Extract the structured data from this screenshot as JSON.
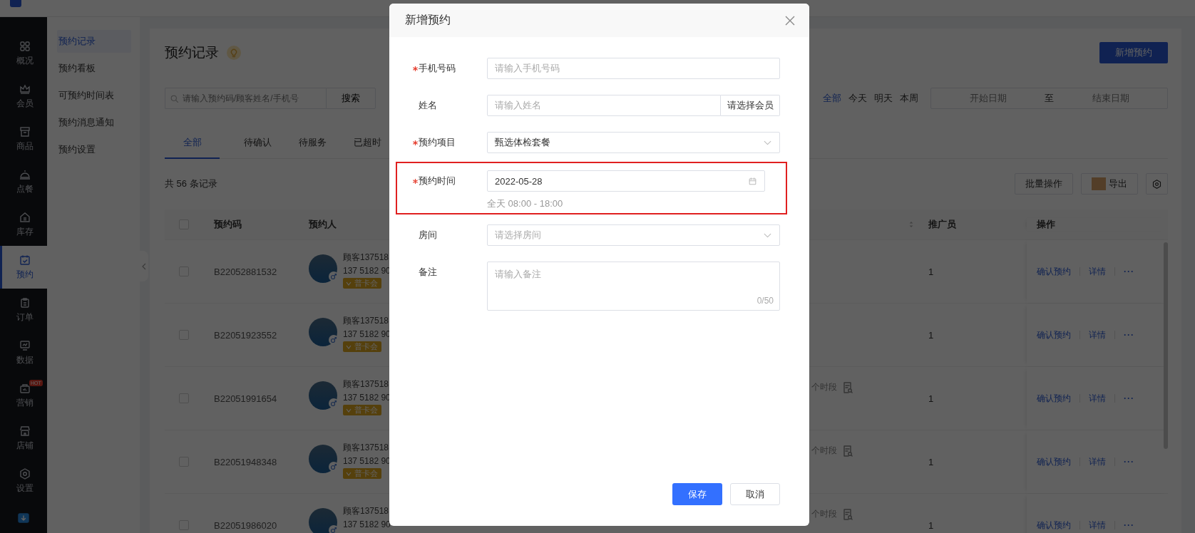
{
  "nav": {
    "items": [
      {
        "label": "概况",
        "selected": false
      },
      {
        "label": "会员",
        "selected": false
      },
      {
        "label": "商品",
        "selected": false
      },
      {
        "label": "点餐",
        "selected": false
      },
      {
        "label": "库存",
        "selected": false
      },
      {
        "label": "预约",
        "selected": true
      },
      {
        "label": "订单",
        "selected": false
      },
      {
        "label": "数据",
        "selected": false
      },
      {
        "label": "营销",
        "selected": false,
        "badge": "HOT"
      },
      {
        "label": "店铺",
        "selected": false
      },
      {
        "label": "设置",
        "selected": false
      }
    ]
  },
  "submenu": {
    "items": [
      {
        "label": "预约记录",
        "selected": true
      },
      {
        "label": "预约看板",
        "selected": false
      },
      {
        "label": "可预约时间表",
        "selected": false
      },
      {
        "label": "预约消息通知",
        "selected": false
      },
      {
        "label": "预约设置",
        "selected": false
      }
    ]
  },
  "page": {
    "title": "预约记录",
    "add_button": "新增预约",
    "search": {
      "placeholder": "请输入预约码/顾客姓名/手机号",
      "button": "搜索"
    },
    "date_filters": [
      {
        "label": "全部",
        "selected": true
      },
      {
        "label": "今天",
        "selected": false
      },
      {
        "label": "明天",
        "selected": false
      },
      {
        "label": "本周",
        "selected": false
      }
    ],
    "date_range": {
      "start_placeholder": "开始日期",
      "separator": "至",
      "end_placeholder": "结束日期"
    },
    "tabs": [
      {
        "label": "全部",
        "selected": true
      },
      {
        "label": "待确认",
        "selected": false
      },
      {
        "label": "待服务",
        "selected": false
      },
      {
        "label": "已超时",
        "selected": false
      }
    ],
    "total": "共 56 条记录",
    "batch_button": "批量操作",
    "export_button": "导出"
  },
  "table": {
    "all_checked": false,
    "columns": [
      "预约码",
      "预约人",
      "推广员",
      "操作"
    ],
    "rows": [
      {
        "checked": false,
        "code": "B22052881532",
        "name": "顾客137518",
        "phone": "137 5182 90",
        "badge": "普卡会",
        "promoter": "1",
        "actions": [
          "确认预约",
          "详情",
          "···"
        ]
      },
      {
        "checked": false,
        "code": "B22051923552",
        "name": "顾客137518",
        "phone": "137 5182 90",
        "badge": "普卡会",
        "promoter": "1",
        "actions": [
          "确认预约",
          "详情",
          "···"
        ]
      },
      {
        "checked": false,
        "code": "B22051991654",
        "name": "顾客137518",
        "phone": "137 5182 90",
        "badge": "普卡会",
        "slot": "个时段",
        "promoter": "1",
        "actions": [
          "确认预约",
          "详情",
          "···"
        ]
      },
      {
        "checked": false,
        "code": "B22051948348",
        "name": "顾客137518",
        "phone": "137 5182 90",
        "badge": "普卡会",
        "slot": "个时段",
        "promoter": "1",
        "actions": [
          "确认预约",
          "详情",
          "···"
        ]
      },
      {
        "checked": false,
        "code": "B22051986020",
        "name": "顾客137518",
        "phone": "137 5182 90",
        "slot": "个时段",
        "promoter": "1",
        "actions": [
          "确认预约",
          "详情",
          "···"
        ]
      }
    ]
  },
  "modal": {
    "title": "新增预约",
    "fields": [
      {
        "kind": "text",
        "label": "手机号码",
        "required": true,
        "highlighted": false,
        "placeholder": "请输入手机号码"
      },
      {
        "kind": "addon",
        "label": "姓名",
        "required": false,
        "highlighted": false,
        "placeholder": "请输入姓名",
        "addon": "请选择会员"
      },
      {
        "kind": "select",
        "label": "预约项目",
        "required": true,
        "highlighted": false,
        "value": "甄选体检套餐"
      },
      {
        "kind": "date",
        "label": "预约时间",
        "required": true,
        "highlighted": true,
        "value": "2022-05-28",
        "hint": "全天 08:00 - 18:00"
      },
      {
        "kind": "select",
        "label": "房间",
        "required": false,
        "highlighted": false,
        "placeholder": "请选择房间"
      },
      {
        "kind": "textarea",
        "label": "备注",
        "required": false,
        "highlighted": false,
        "placeholder": "请输入备注",
        "counter": "0/50"
      }
    ],
    "buttons": [
      {
        "label": "保存",
        "kind": "primary"
      },
      {
        "label": "取消",
        "kind": "default"
      }
    ]
  }
}
